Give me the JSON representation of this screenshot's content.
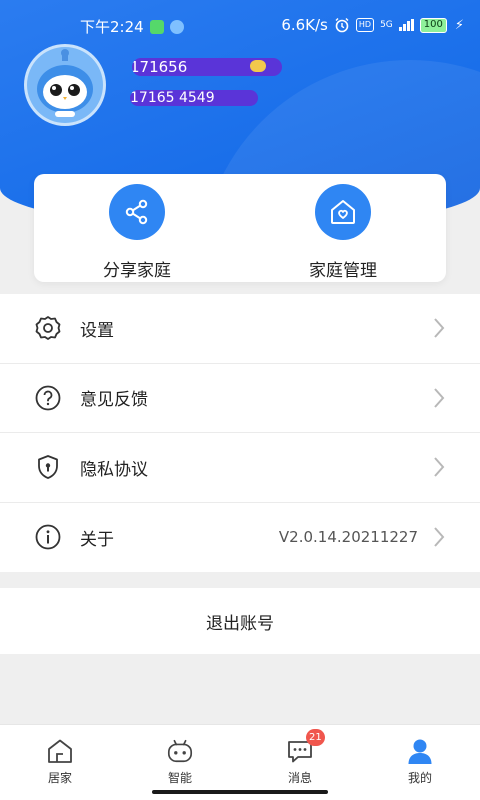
{
  "status_bar": {
    "time": "下午2:24",
    "network_speed": "6.6K/s",
    "network_type": "5G",
    "battery": "100",
    "icons": [
      "wechat-icon",
      "app-icon",
      "alarm-icon",
      "hd-icon",
      "signal-icon",
      "battery-icon",
      "charging-icon"
    ]
  },
  "profile": {
    "name": "171656",
    "phone": "17165    4549"
  },
  "family_card": {
    "actions": [
      {
        "label": "分享家庭",
        "icon": "share-icon"
      },
      {
        "label": "家庭管理",
        "icon": "home-heart-icon"
      }
    ]
  },
  "menu": [
    {
      "label": "设置",
      "icon": "settings-icon",
      "value": ""
    },
    {
      "label": "意见反馈",
      "icon": "question-icon",
      "value": ""
    },
    {
      "label": "隐私协议",
      "icon": "shield-icon",
      "value": ""
    },
    {
      "label": "关于",
      "icon": "info-icon",
      "value": "V2.0.14.20211227"
    }
  ],
  "logout_label": "退出账号",
  "bottom_nav": {
    "tabs": [
      {
        "label": "居家",
        "icon": "home-icon",
        "active": false
      },
      {
        "label": "智能",
        "icon": "robot-icon",
        "active": false
      },
      {
        "label": "消息",
        "icon": "message-icon",
        "active": false,
        "badge": "21"
      },
      {
        "label": "我的",
        "icon": "person-icon",
        "active": true
      }
    ]
  },
  "colors": {
    "primary": "#1a6fea",
    "accent_button": "#2f86f3",
    "badge": "#f0564d",
    "background": "#efefef"
  }
}
